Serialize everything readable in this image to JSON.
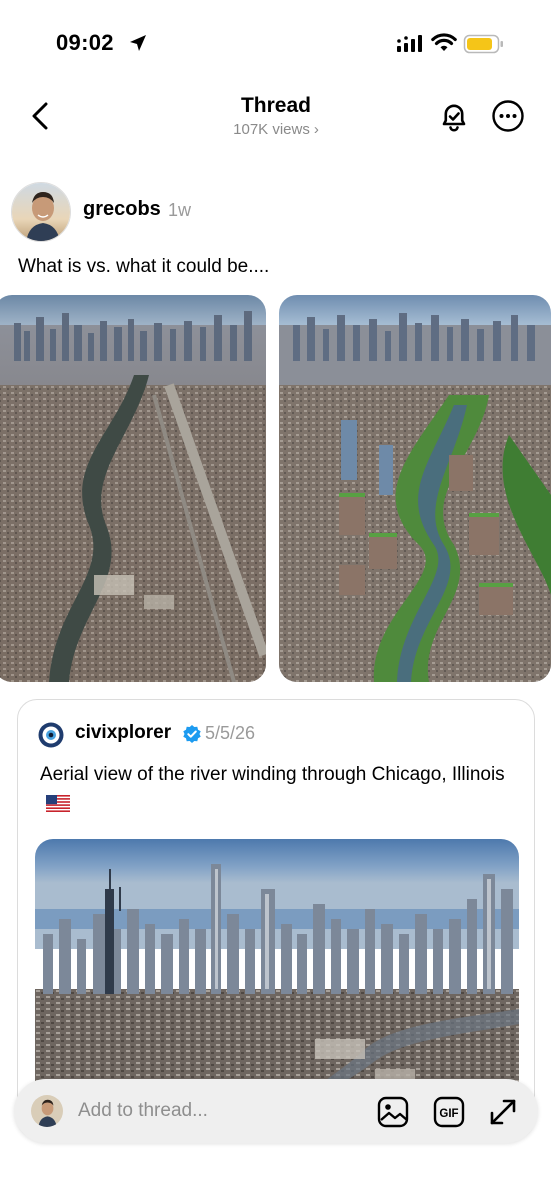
{
  "status_bar": {
    "time": "09:02",
    "icons": [
      "location-arrow-icon",
      "signal-icon",
      "wifi-icon",
      "battery-icon"
    ],
    "battery_color": "#f5c518"
  },
  "header": {
    "title": "Thread",
    "views": "107K views",
    "views_chevron": "›",
    "icons": [
      "back-chevron-icon",
      "bell-check-icon",
      "more-dots-icon"
    ]
  },
  "post": {
    "username": "grecobs",
    "time": "1w",
    "text": "What is vs. what it could be....",
    "images": [
      {
        "name": "aerial-chicago-river-current"
      },
      {
        "name": "aerial-chicago-river-reimagined"
      }
    ]
  },
  "quote": {
    "username": "civixplorer",
    "verified": true,
    "date": "5/5/26",
    "text": "Aerial view of the river winding through Chicago, Illinois",
    "flag": "us-flag-icon",
    "image": {
      "name": "aerial-chicago-skyline"
    }
  },
  "composer": {
    "placeholder": "Add to thread...",
    "gif_label": "GIF",
    "icons": [
      "image-icon",
      "gif-icon",
      "expand-icon"
    ]
  },
  "colors": {
    "text": "#000000",
    "muted": "#8a8a8a",
    "verified": "#1d9bf0",
    "composer_bg": "#efefef"
  }
}
